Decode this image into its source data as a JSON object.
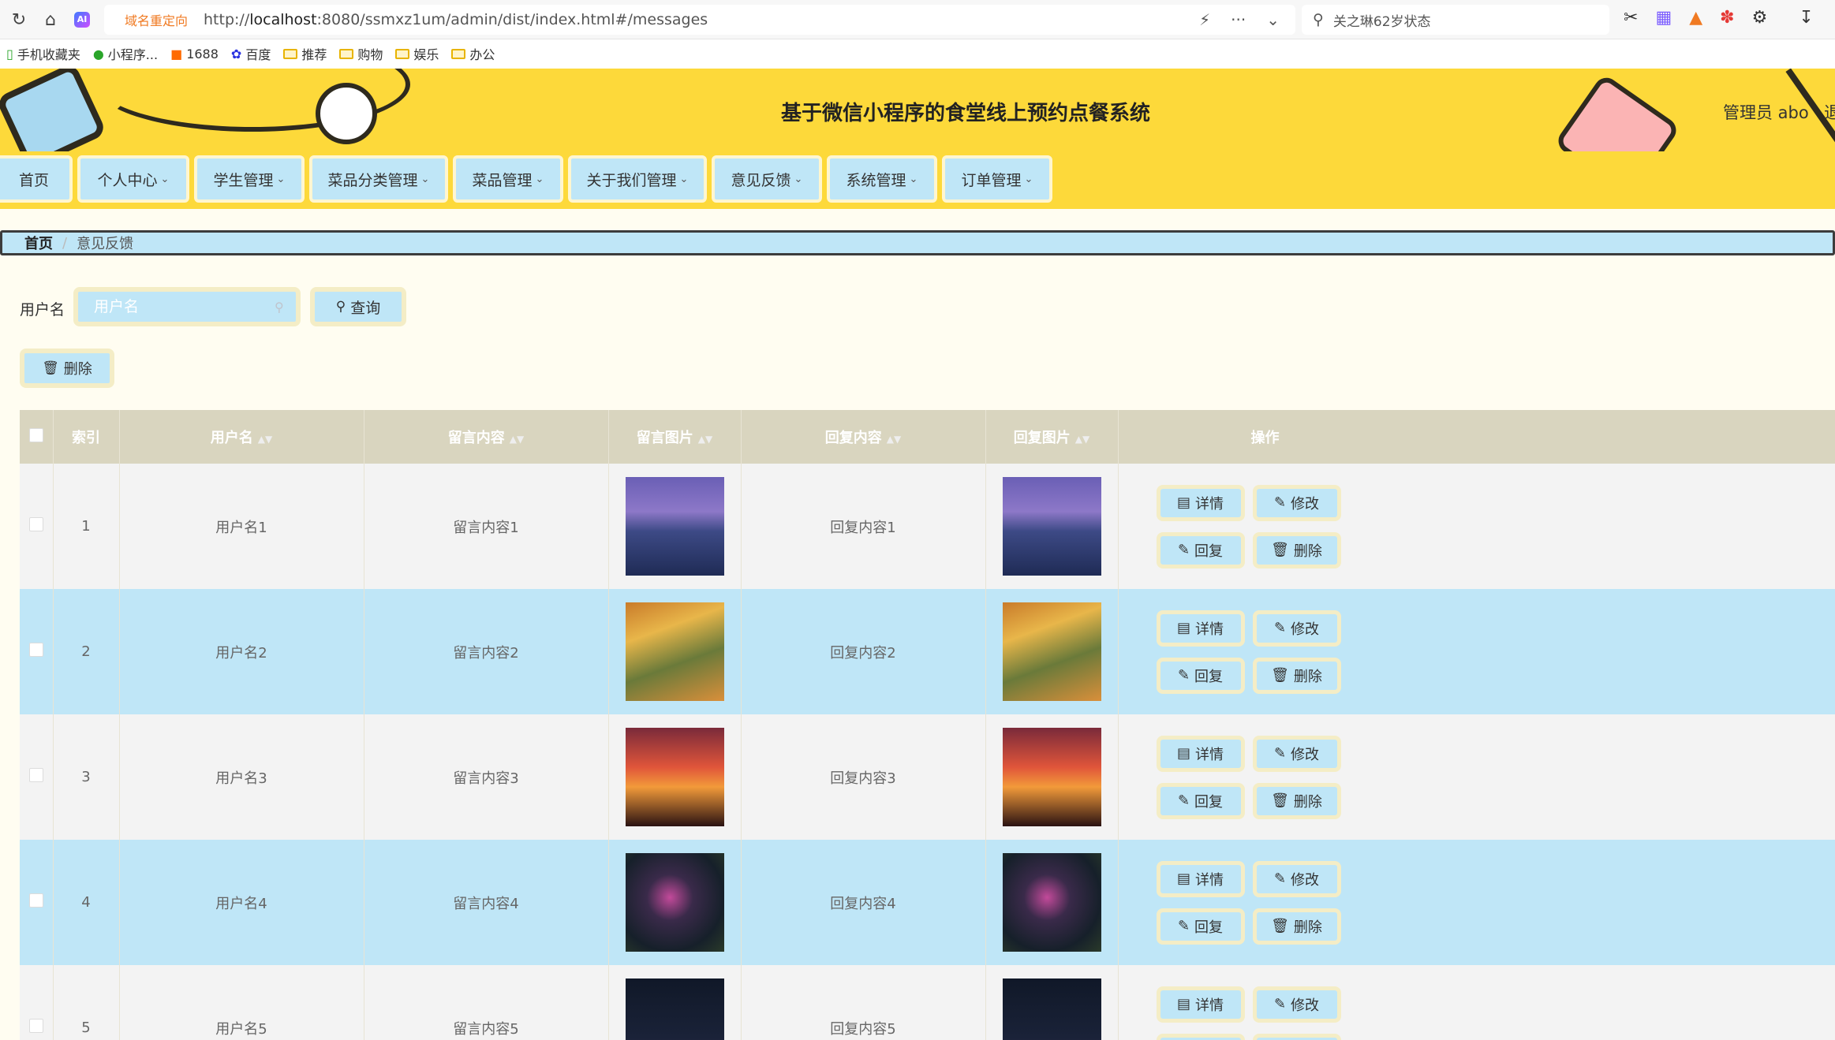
{
  "browser": {
    "redirect_tag": "域名重定向",
    "url_prefix": "http://",
    "url_host": "localhost",
    "url_rest": ":8080/ssmxz1um/admin/dist/index.html#/messages",
    "search_text": "关之琳62岁状态"
  },
  "bookmarks": [
    {
      "label": "手机收藏夹"
    },
    {
      "label": "小程序..."
    },
    {
      "label": "1688"
    },
    {
      "label": "百度"
    },
    {
      "label": "推荐"
    },
    {
      "label": "购物"
    },
    {
      "label": "娱乐"
    },
    {
      "label": "办公"
    }
  ],
  "header": {
    "title": "基于微信小程序的食堂线上预约点餐系统",
    "admin": "管理员 abo",
    "extra": "退"
  },
  "menu": [
    {
      "label": "首页"
    },
    {
      "label": "个人中心"
    },
    {
      "label": "学生管理"
    },
    {
      "label": "菜品分类管理"
    },
    {
      "label": "菜品管理"
    },
    {
      "label": "关于我们管理"
    },
    {
      "label": "意见反馈"
    },
    {
      "label": "系统管理"
    },
    {
      "label": "订单管理"
    }
  ],
  "breadcrumb": {
    "home": "首页",
    "current": "意见反馈"
  },
  "search": {
    "label": "用户名",
    "placeholder": "用户名",
    "button": "查询"
  },
  "batch_delete": "删除",
  "table": {
    "headers": {
      "index": "索引",
      "username": "用户名",
      "content": "留言内容",
      "image": "留言图片",
      "reply": "回复内容",
      "reply_image": "回复图片",
      "ops": "操作"
    },
    "rows": [
      {
        "index": "1",
        "username": "用户名1",
        "content": "留言内容1",
        "reply": "回复内容1"
      },
      {
        "index": "2",
        "username": "用户名2",
        "content": "留言内容2",
        "reply": "回复内容2"
      },
      {
        "index": "3",
        "username": "用户名3",
        "content": "留言内容3",
        "reply": "回复内容3"
      },
      {
        "index": "4",
        "username": "用户名4",
        "content": "留言内容4",
        "reply": "回复内容4"
      },
      {
        "index": "5",
        "username": "用户名5",
        "content": "留言内容5",
        "reply": "回复内容5"
      }
    ],
    "actions": {
      "detail": "详情",
      "edit": "修改",
      "reply": "回复",
      "delete": "删除"
    }
  },
  "colors": {
    "header_yellow": "#fdd93a",
    "button_blue": "#bfe6f7",
    "button_border": "#f4edc6",
    "table_header": "#d9d5bf",
    "page_bg": "#fffdf1"
  }
}
